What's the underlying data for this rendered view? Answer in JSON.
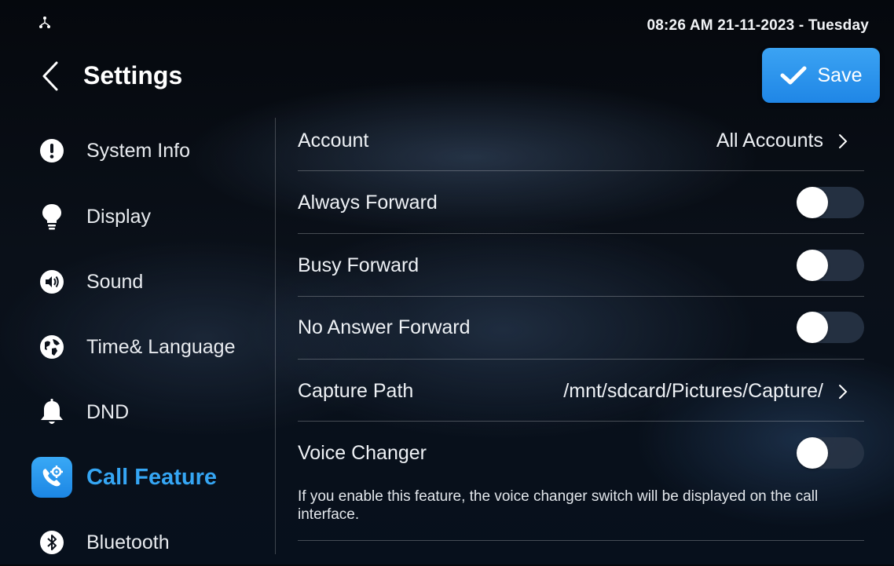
{
  "status_bar": {
    "datetime": "08:26 AM  21-11-2023 - Tuesday",
    "network_icon": "network-icon"
  },
  "header": {
    "title": "Settings",
    "back_icon": "chevron-left-icon",
    "save_label": "Save",
    "save_icon": "check-icon"
  },
  "sidebar": {
    "items": [
      {
        "label": "System Info",
        "icon": "info-exclamation-icon"
      },
      {
        "label": "Display",
        "icon": "lightbulb-icon"
      },
      {
        "label": "Sound",
        "icon": "speaker-icon"
      },
      {
        "label": "Time& Language",
        "icon": "globe-icon"
      },
      {
        "label": "DND",
        "icon": "bell-icon"
      },
      {
        "label": "Call Feature",
        "icon": "phone-gear-icon",
        "active": true
      },
      {
        "label": "Bluetooth",
        "icon": "bluetooth-icon"
      }
    ]
  },
  "main": {
    "account": {
      "label": "Account",
      "value": "All Accounts"
    },
    "always_forward": {
      "label": "Always Forward",
      "enabled": false
    },
    "busy_forward": {
      "label": "Busy Forward",
      "enabled": false
    },
    "no_answer_forward": {
      "label": "No Answer Forward",
      "enabled": false
    },
    "capture_path": {
      "label": "Capture Path",
      "value": "/mnt/sdcard/Pictures/Capture/"
    },
    "voice_changer": {
      "label": "Voice Changer",
      "enabled": false,
      "help": "If you enable this feature, the voice changer switch will be displayed on the call interface."
    }
  },
  "colors": {
    "accent": "#35a6f4",
    "save_bg": "#1f86e6",
    "toggle_track": "#28344a"
  }
}
